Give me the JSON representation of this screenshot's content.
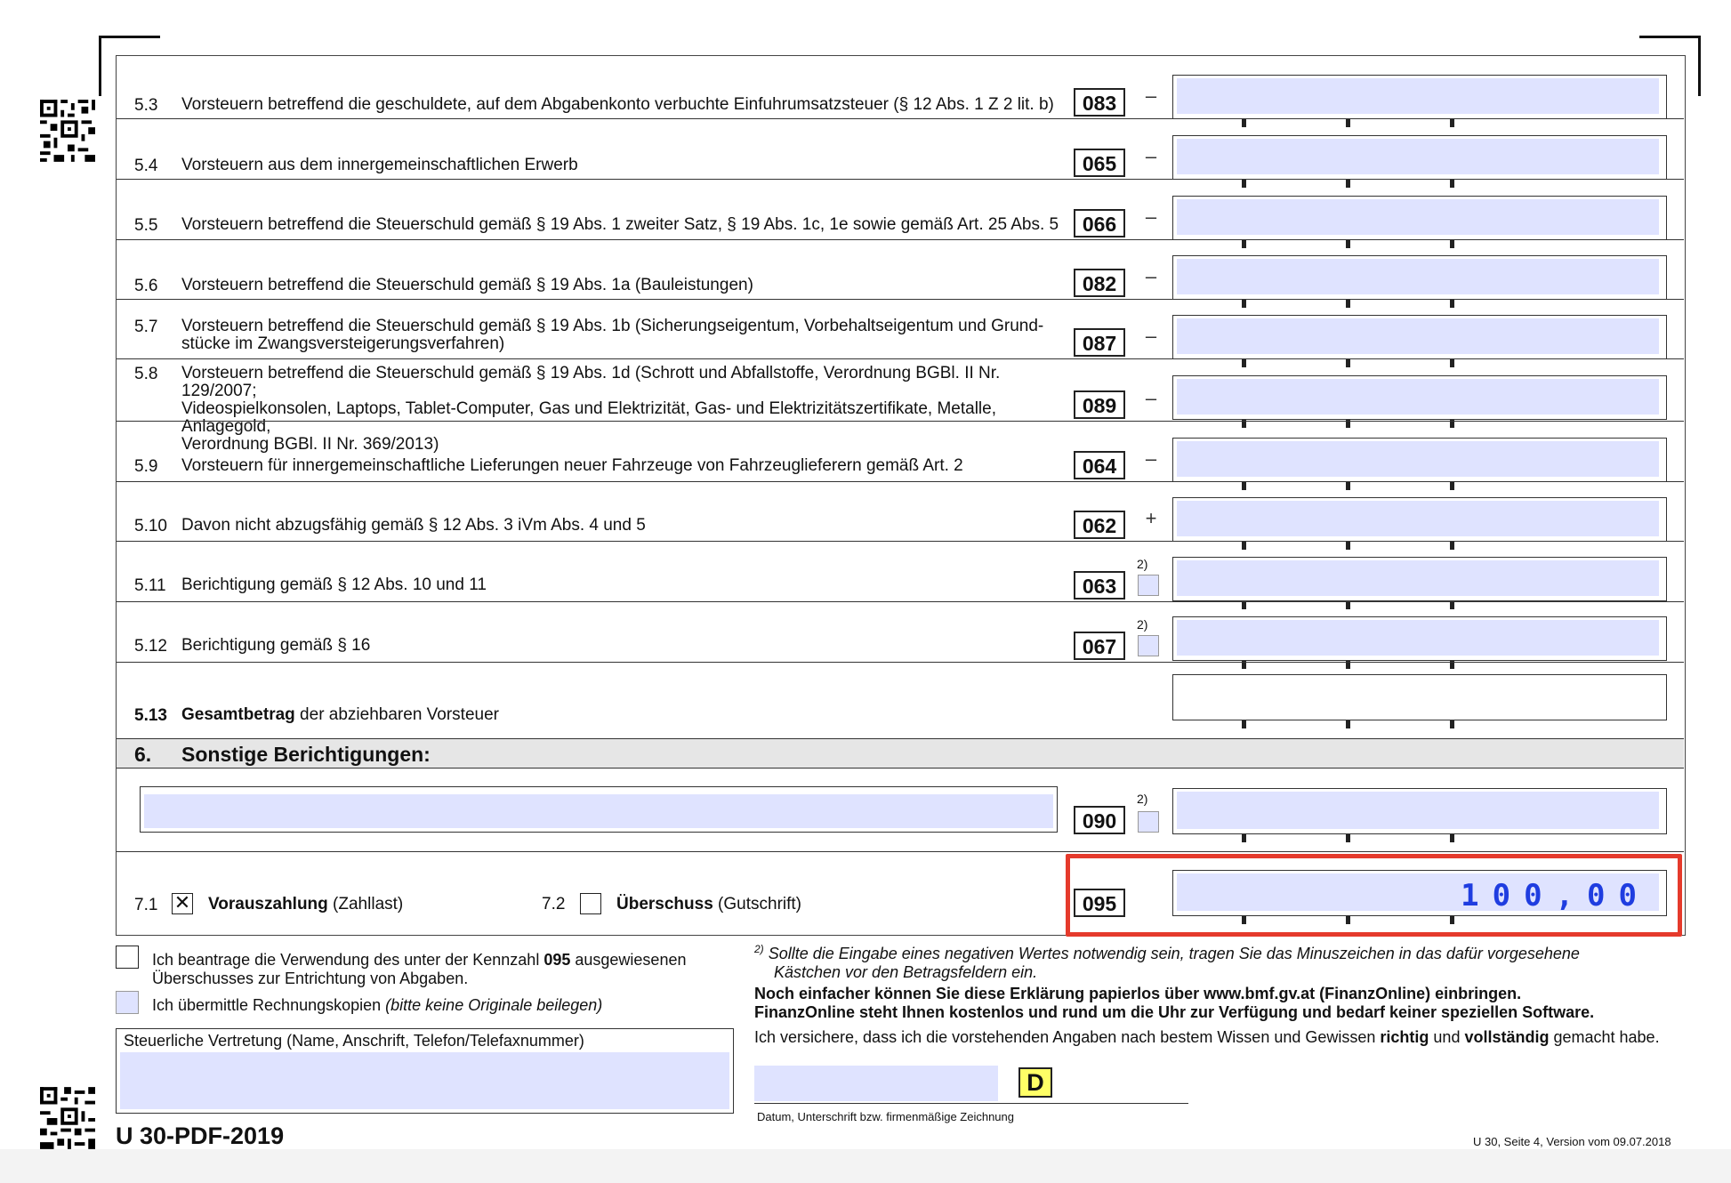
{
  "rows": [
    {
      "num": "5.3",
      "desc": "Vorsteuern betreffend die geschuldete, auf dem Abgabenkonto verbuchte Einfuhrumsatzsteuer (§ 12 Abs. 1 Z 2 lit. b)",
      "kz": "083",
      "sign": "–"
    },
    {
      "num": "5.4",
      "desc": "Vorsteuern aus dem innergemeinschaftlichen Erwerb",
      "kz": "065",
      "sign": "–"
    },
    {
      "num": "5.5",
      "desc": "Vorsteuern betreffend die Steuerschuld gemäß § 19 Abs. 1 zweiter Satz, § 19 Abs. 1c, 1e sowie gemäß Art. 25 Abs. 5",
      "kz": "066",
      "sign": "–"
    },
    {
      "num": "5.6",
      "desc": "Vorsteuern betreffend die Steuerschuld gemäß § 19 Abs. 1a (Bauleistungen)",
      "kz": "082",
      "sign": "–"
    },
    {
      "num": "5.7",
      "desc": "Vorsteuern betreffend die Steuerschuld gemäß § 19 Abs. 1b (Sicherungseigentum, Vorbehaltseigentum und Grund-\nstücke im Zwangsversteigerungsverfahren)",
      "kz": "087",
      "sign": "–"
    },
    {
      "num": "5.8",
      "desc": "Vorsteuern betreffend die Steuerschuld gemäß § 19 Abs. 1d (Schrott und Abfallstoffe, Verordnung BGBl. II Nr. 129/2007;\nVideospielkonsolen, Laptops, Tablet-Computer, Gas und Elektrizität, Gas- und Elektrizitätszertifikate, Metalle, Anlagegold,\nVerordnung BGBl. II Nr. 369/2013)",
      "kz": "089",
      "sign": "–"
    },
    {
      "num": "5.9",
      "desc": "Vorsteuern für innergemeinschaftliche Lieferungen neuer Fahrzeuge von Fahrzeuglieferern gemäß Art. 2",
      "kz": "064",
      "sign": "–"
    },
    {
      "num": "5.10",
      "desc": "Davon nicht abzugsfähig gemäß § 12 Abs. 3 iVm Abs. 4 und 5",
      "kz": "062",
      "sign": "+"
    },
    {
      "num": "5.11",
      "desc": "Berichtigung gemäß § 12 Abs. 10 und 11",
      "kz": "063",
      "sup": "2)"
    },
    {
      "num": "5.12",
      "desc": "Berichtigung gemäß § 16",
      "kz": "067",
      "sup": "2)"
    }
  ],
  "row513": {
    "num": "5.13",
    "bold": "Gesamtbetrag",
    "rest": " der abziehbaren Vorsteuer"
  },
  "section6": {
    "num": "6.",
    "title": "Sonstige Berichtigungen:",
    "kz": "090",
    "sup": "2)"
  },
  "section7": {
    "num1": "7.1",
    "bold1": "Vorauszahlung",
    "rest1": " (Zahllast)",
    "check1": "✕",
    "num2": "7.2",
    "bold2": "Überschuss",
    "rest2": " (Gutschrift)",
    "kz": "095",
    "amount": "100,00"
  },
  "footer": {
    "opt1_a": "Ich beantrage die Verwendung des unter der Kennzahl ",
    "opt1_kz": "095",
    "opt1_b": " ausgewiesenen",
    "opt1_c": "Überschusses zur Entrichtung von Abgaben.",
    "opt2": "Ich übermittle Rechnungskopien ",
    "opt2_i": "(bitte keine Originale beilegen)",
    "rep_label": "Steuerliche Vertretung (Name, Anschrift, Telefon/Telefaxnummer)",
    "fn_mark": "2)",
    "fn_line1": "Sollte die Eingabe eines negativen Wertes notwendig sein, tragen Sie das Minuszeichen in das dafür vorgesehene",
    "fn_line2": "Kästchen vor den Betragsfeldern ein.",
    "info1": "Noch einfacher können Sie diese Erklärung papierlos über www.bmf.gv.at (FinanzOnline) einbringen.",
    "info2": "FinanzOnline steht Ihnen kostenlos und rund um die Uhr zur Verfügung und bedarf keiner speziellen Software.",
    "assure_a": "Ich versichere, dass ich die vorstehenden Angaben nach bestem Wissen und Gewissen ",
    "assure_b": "richtig",
    "assure_c": " und ",
    "assure_d": "vollständig",
    "assure_e": " gemacht habe.",
    "d_mark": "D",
    "sig_label": "Datum, Unterschrift bzw. firmenmäßige Zeichnung",
    "form_id": "U 30-PDF-2019",
    "page_info": "U 30, Seite 4, Version vom 09.07.2018"
  }
}
